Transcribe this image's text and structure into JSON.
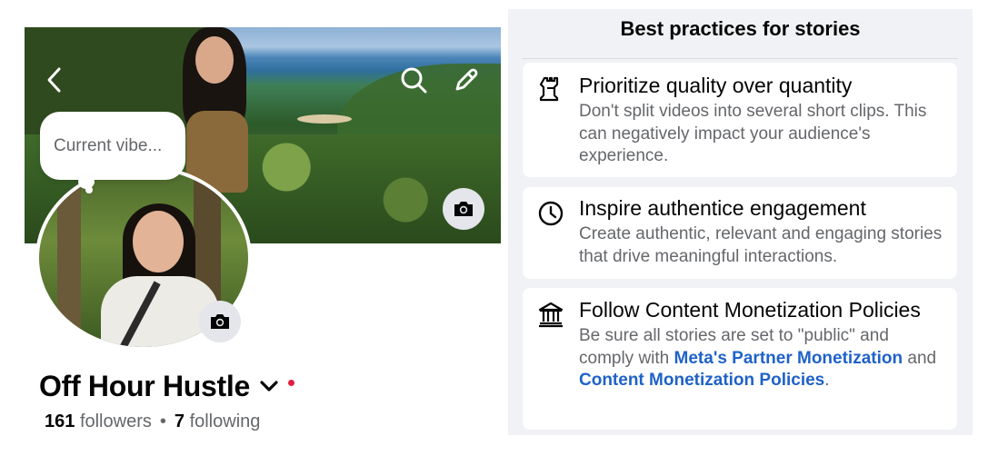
{
  "profile": {
    "vibe_placeholder": "Current vibe...",
    "name": "Off Hour Hustle",
    "followers_count": "161",
    "followers_label": "followers",
    "separator": "•",
    "following_count": "7",
    "following_label": "following"
  },
  "icons": {
    "back": "chevron-left-icon",
    "search": "search-icon",
    "edit": "pencil-icon",
    "cover_camera": "camera-icon",
    "avatar_camera": "camera-icon",
    "name_menu": "chevron-down-icon"
  },
  "best_practices": {
    "title": "Best practices for stories",
    "cards": [
      {
        "icon": "chess-rook-icon",
        "title": "Prioritize quality over quantity",
        "body": "Don't split videos into several short clips. This can negatively impact your audience's experience."
      },
      {
        "icon": "clock-icon",
        "title": "Inspire authentice engagement",
        "body": "Create authentic, relevant and engaging stories that drive meaningful interactions."
      },
      {
        "icon": "bank-icon",
        "title": "Follow Content Monetization Policies",
        "body_start": "Be sure all stories are set to \"public\" and comply with ",
        "link1": "Meta's Partner Monetization",
        "body_mid": " and ",
        "link2": "Content Monetization Policies",
        "body_end": "."
      }
    ]
  },
  "colors": {
    "link": "#1f62c8",
    "notification_dot": "#e41e3f",
    "panel_bg": "#f0f2f5",
    "secondary_text": "#65676b"
  }
}
